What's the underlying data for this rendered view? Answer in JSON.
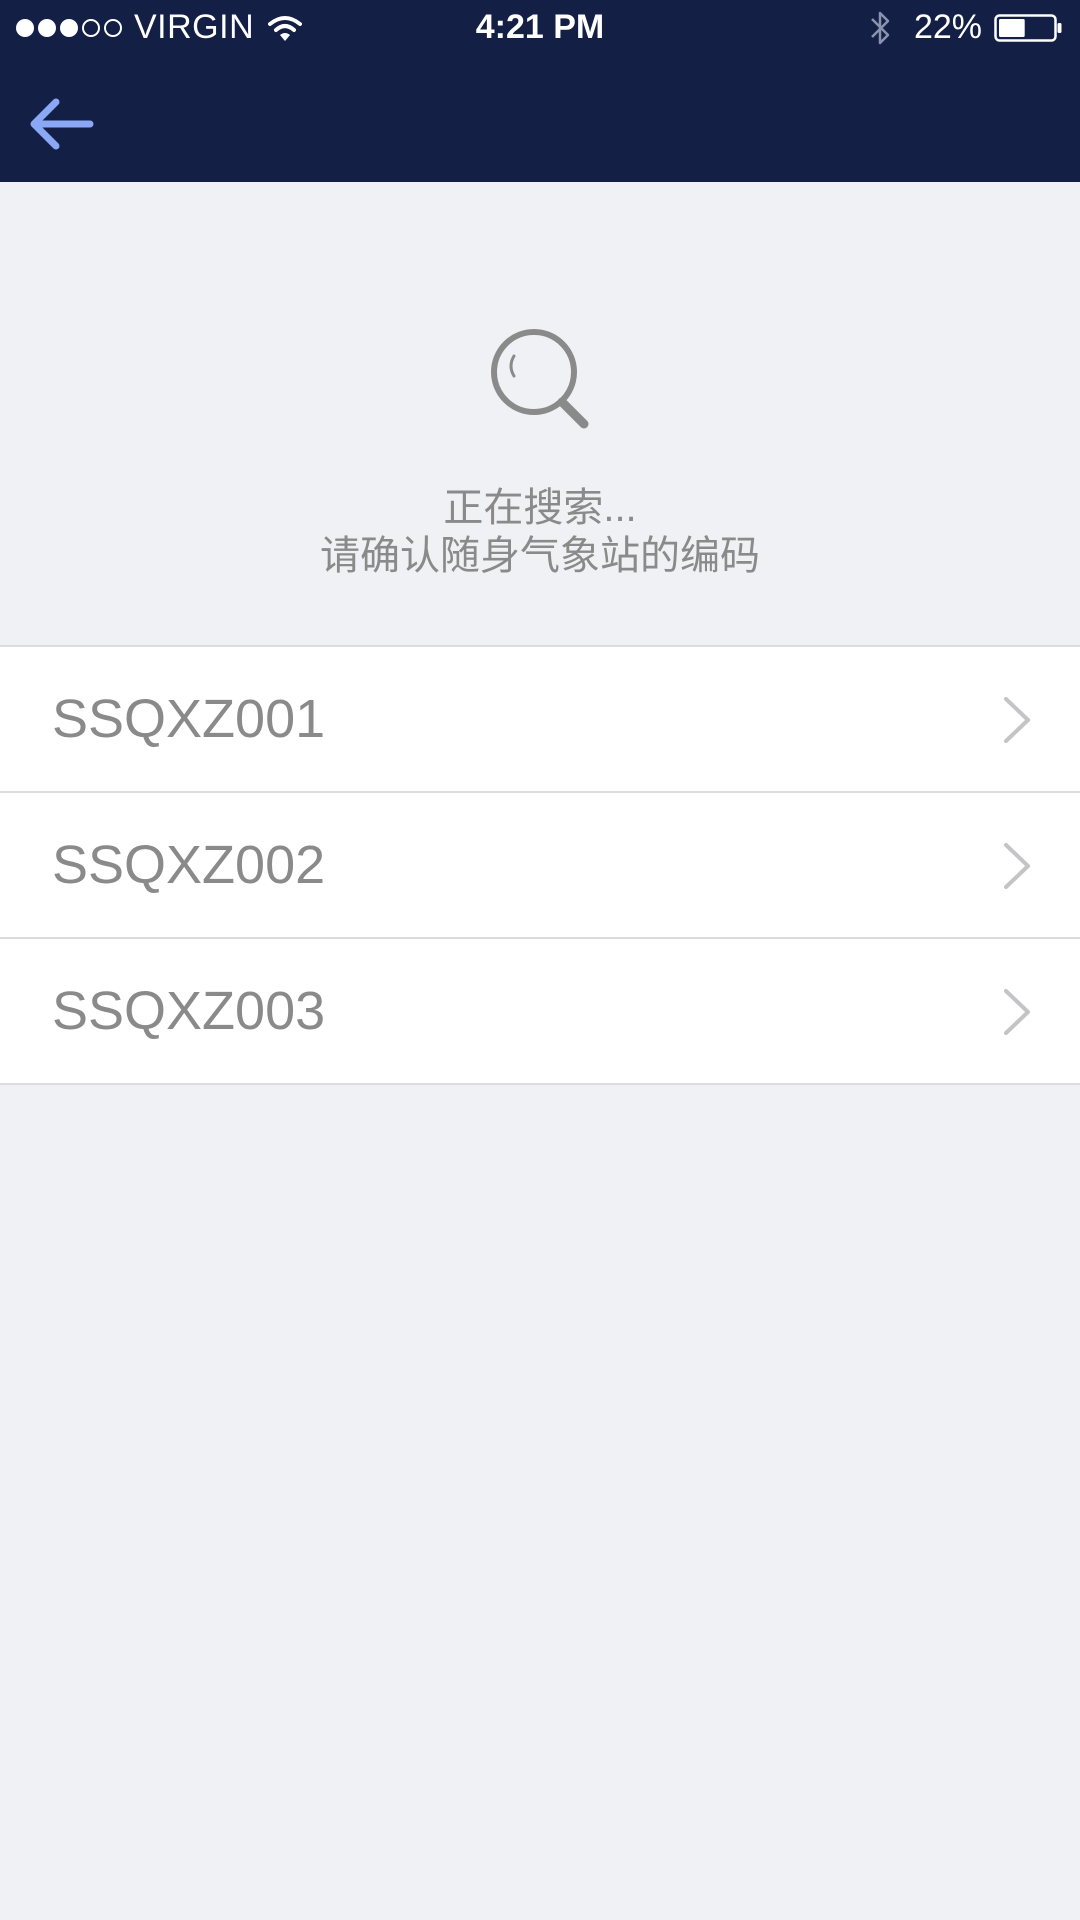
{
  "status_bar": {
    "carrier": "VIRGIN",
    "time": "4:21 PM",
    "battery_percent": "22%",
    "battery_level": 0.22,
    "signal_bars_filled": 3,
    "signal_bars_total": 5
  },
  "header": {
    "back_icon": "arrow-left-icon",
    "background_color": "#131f45",
    "accent_color": "#8aa8f5"
  },
  "search": {
    "icon": "search-icon",
    "status_text": "正在搜索...",
    "instruction_text": "请确认随身气象站的编码"
  },
  "devices": [
    {
      "name": "SSQXZ001"
    },
    {
      "name": "SSQXZ002"
    },
    {
      "name": "SSQXZ003"
    }
  ]
}
